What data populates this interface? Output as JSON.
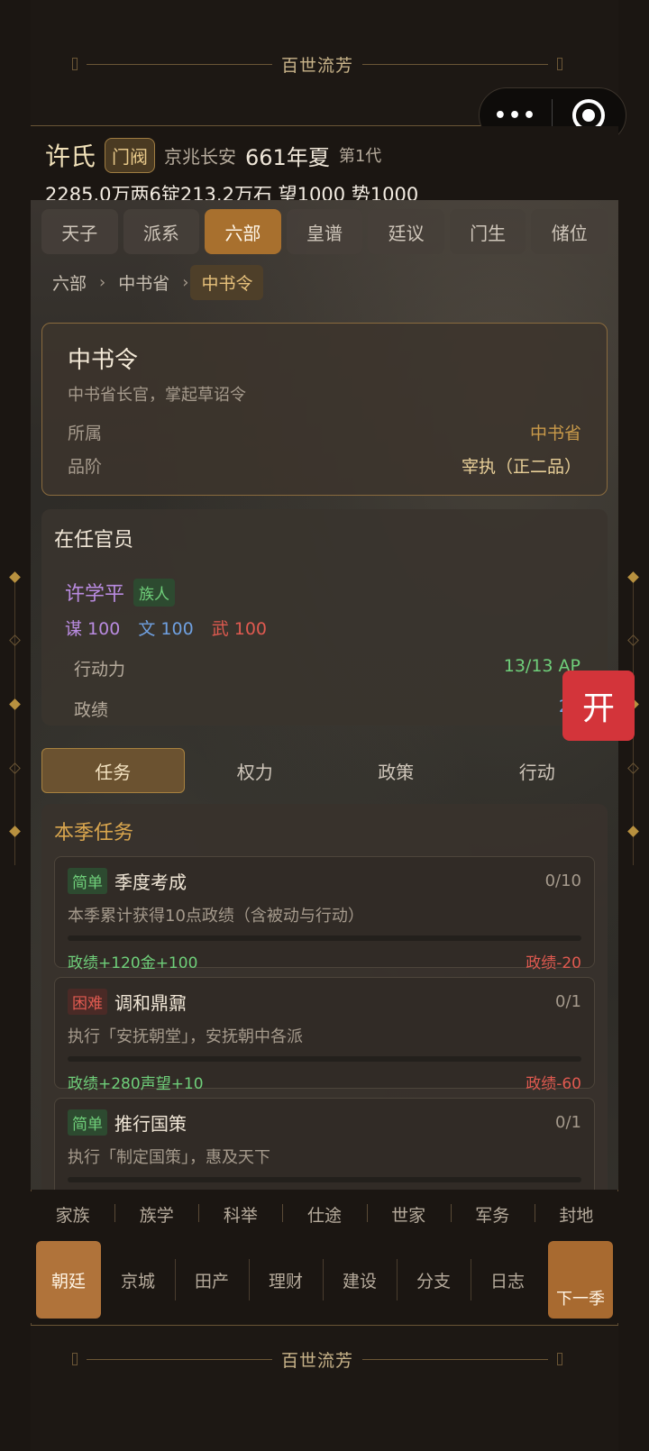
{
  "app_title": "百世流芳",
  "capsule": {
    "menu_icon": "more-dots-icon",
    "close_icon": "target-icon"
  },
  "header": {
    "clan": "许氏",
    "clan_badge": "门阀",
    "location": "京兆长安",
    "year_season": "661年夏",
    "generation": "第1代",
    "resources": "2285.0万两6锭213.2万石  望1000 势1000"
  },
  "tabs": [
    "天子",
    "派系",
    "六部",
    "皇谱",
    "廷议",
    "门生",
    "储位"
  ],
  "active_tab": "六部",
  "breadcrumb": [
    "六部",
    "中书省",
    "中书令"
  ],
  "office": {
    "title": "中书令",
    "desc": "中书省长官，掌起草诏令",
    "affiliation_label": "所属",
    "affiliation_value": "中书省",
    "rank_label": "品阶",
    "rank_value": "宰执（正二品）"
  },
  "official": {
    "section_title": "在任官员",
    "name": "许学平",
    "tag": "族人",
    "stat_mou": "谋 100",
    "stat_wen": "文 100",
    "stat_wu": "武 100",
    "ap_label": "行动力",
    "ap_value": "13/13 AP",
    "merit_label": "政绩",
    "merit_value": "26"
  },
  "open_button": "开",
  "subtabs": [
    "任务",
    "权力",
    "政策",
    "行动"
  ],
  "tasks": {
    "section_title": "本季任务",
    "items": [
      {
        "difficulty": "简单",
        "name": "季度考成",
        "progress": "0/10",
        "desc": "本季累计获得10点政绩（含被动与行动）",
        "reward": "政绩+120金+100",
        "penalty": "政绩-20"
      },
      {
        "difficulty": "困难",
        "name": "调和鼎鼐",
        "progress": "0/1",
        "desc": "执行「安抚朝堂」，安抚朝中各派",
        "reward": "政绩+280声望+10",
        "penalty": "政绩-60"
      },
      {
        "difficulty": "简单",
        "name": "推行国策",
        "progress": "0/1",
        "desc": "执行「制定国策」，惠及天下",
        "reward": "",
        "penalty": ""
      }
    ]
  },
  "nav_top": [
    "家族",
    "族学",
    "科举",
    "仕途",
    "世家",
    "军务",
    "封地"
  ],
  "nav_bottom": [
    "朝廷",
    "京城",
    "田产",
    "理财",
    "建设",
    "分支",
    "日志"
  ],
  "next_season": "下一季"
}
